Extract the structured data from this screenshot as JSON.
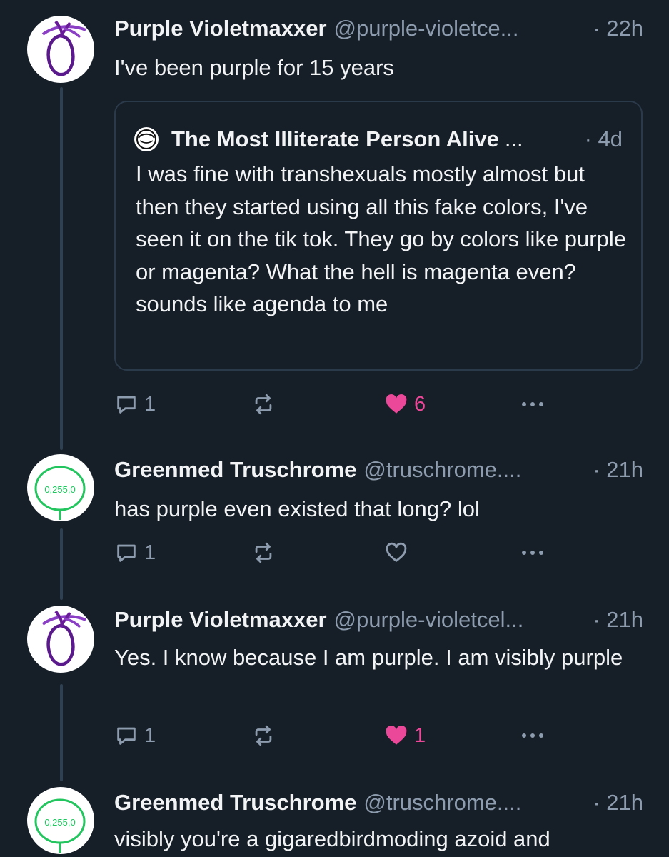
{
  "posts": [
    {
      "author": "Purple Violetmaxxer",
      "handle": "@purple-violetce...",
      "time": "· 22h",
      "text": "I've been purple for 15 years",
      "avatar_icon": "purple-circle-avatar-icon",
      "quote": {
        "author": "The Most Illiterate Person Alive",
        "ellipsis": "...",
        "time": "· 4d",
        "text": "I was fine with transhexuals mostly almost but then they started using all this fake colors, I've seen it on the tik tok. They go by colors like purple or magenta? What the hell is magenta even? sounds like agenda to me",
        "avatar_icon": "sketch-face-avatar-icon"
      },
      "actions": {
        "replies": "1",
        "reposts": "",
        "likes": "6",
        "liked": true
      }
    },
    {
      "author": "Greenmed Truschrome",
      "handle": "@truschrome....",
      "time": "· 21h",
      "text": "has purple even existed that long? lol",
      "avatar_icon": "green-circle-avatar-icon",
      "avatar_label": "0,255,0",
      "actions": {
        "replies": "1",
        "reposts": "",
        "likes": "",
        "liked": false
      }
    },
    {
      "author": "Purple Violetmaxxer",
      "handle": "@purple-violetcel...",
      "time": "· 21h",
      "text": "Yes. I know because I am purple. I am visibly purple",
      "avatar_icon": "purple-circle-avatar-icon",
      "actions": {
        "replies": "1",
        "reposts": "",
        "likes": "1",
        "liked": true
      }
    },
    {
      "author": "Greenmed Truschrome",
      "handle": "@truschrome....",
      "time": "· 21h",
      "text": "visibly you're a gigaredbirdmoding azoid and",
      "avatar_icon": "green-circle-avatar-icon",
      "avatar_label": "0,255,0"
    }
  ],
  "colors": {
    "background": "#161e27",
    "text": "#f1f3f5",
    "muted": "#8d9cae",
    "like": "#ec4899",
    "thread_line": "#2e4052",
    "purple_avatar": "#6a1b9a",
    "green_avatar": "#22c55e"
  }
}
